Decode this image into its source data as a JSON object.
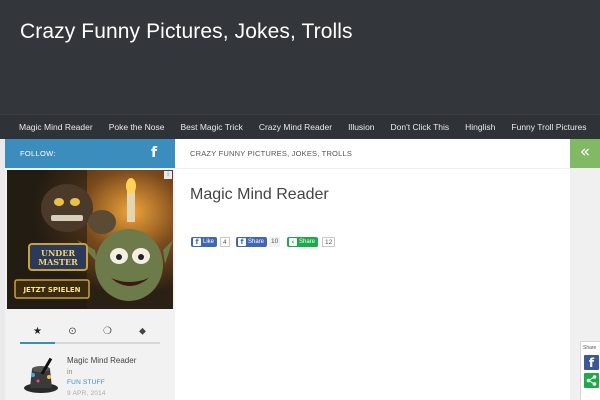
{
  "site": {
    "title": "Crazy Funny Pictures, Jokes, Trolls"
  },
  "nav": {
    "items": [
      "Magic Mind Reader",
      "Poke the Nose",
      "Best Magic Trick",
      "Crazy Mind Reader",
      "Illusion",
      "Don't Click This",
      "Hinglish",
      "Funny Troll Pictures"
    ]
  },
  "sidebar": {
    "follow_label": "FOLLOW:",
    "follow_icon": "facebook-icon",
    "tabs": [
      {
        "icon": "star-icon",
        "glyph": "★"
      },
      {
        "icon": "clock-icon",
        "glyph": "⊙"
      },
      {
        "icon": "comments-icon",
        "glyph": "❍"
      },
      {
        "icon": "tags-icon",
        "glyph": "⬥"
      }
    ],
    "post": {
      "title": "Magic Mind Reader",
      "in_label": "in",
      "category": "FUN STUFF",
      "date": "9 APR, 2014"
    }
  },
  "ad": {
    "choice_label": "i"
  },
  "main": {
    "breadcrumb": "CRAZY FUNNY PICTURES, JOKES, TROLLS",
    "page_title": "Magic Mind Reader",
    "share": {
      "like_label": "Like",
      "like_count": "4",
      "share_label": "Share",
      "share_count": "10",
      "g_share_label": "Share",
      "g_share_count": "12"
    }
  },
  "right": {
    "collapse_glyph": "«"
  },
  "share_widget": {
    "label": "Share"
  },
  "colors": {
    "header_bg": "#33363b",
    "accent_blue": "#3b8dbd",
    "accent_green": "#82b965",
    "facebook_blue": "#3b5998",
    "share_green": "#1ea94b"
  }
}
